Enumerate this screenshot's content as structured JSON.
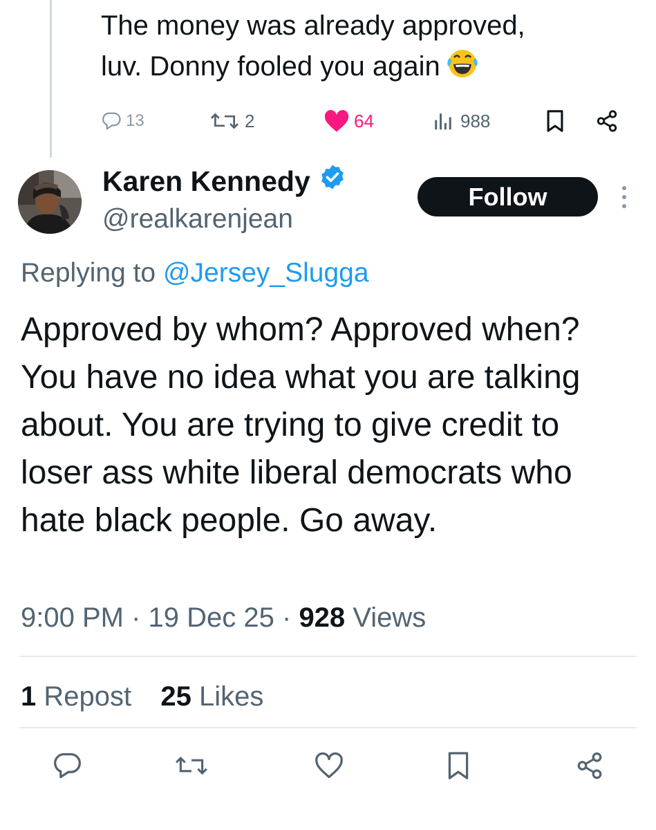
{
  "previous_tweet": {
    "text_line1": "The money was already approved,",
    "text_line2": "luv. Donny fooled you again",
    "emoji": "face-with-tears-of-joy",
    "actions": {
      "replies": "13",
      "reposts": "2",
      "likes": "64",
      "views": "988"
    },
    "liked_color": "#f91880"
  },
  "tweet": {
    "author": {
      "name": "Karen Kennedy",
      "handle": "@realkarenjean",
      "verified": true,
      "verified_color": "#1d9bf0"
    },
    "follow_label": "Follow",
    "replying_prefix": "Replying to",
    "replying_to": "@Jersey_Slugga",
    "text": "Approved by whom? Approved when? You have no idea what you are talking about. You are trying to give credit to loser ass white liberal democrats who hate black people. Go away.",
    "time": "9:00 PM",
    "date": "19 Dec 25",
    "views_count": "928",
    "views_label": "Views",
    "repost_count": "1",
    "repost_label": "Repost",
    "likes_count": "25",
    "likes_label": "Likes"
  },
  "colors": {
    "text_primary": "#0f1419",
    "text_secondary": "#536471",
    "link": "#1d9bf0",
    "thread_line": "#cfd9de"
  }
}
